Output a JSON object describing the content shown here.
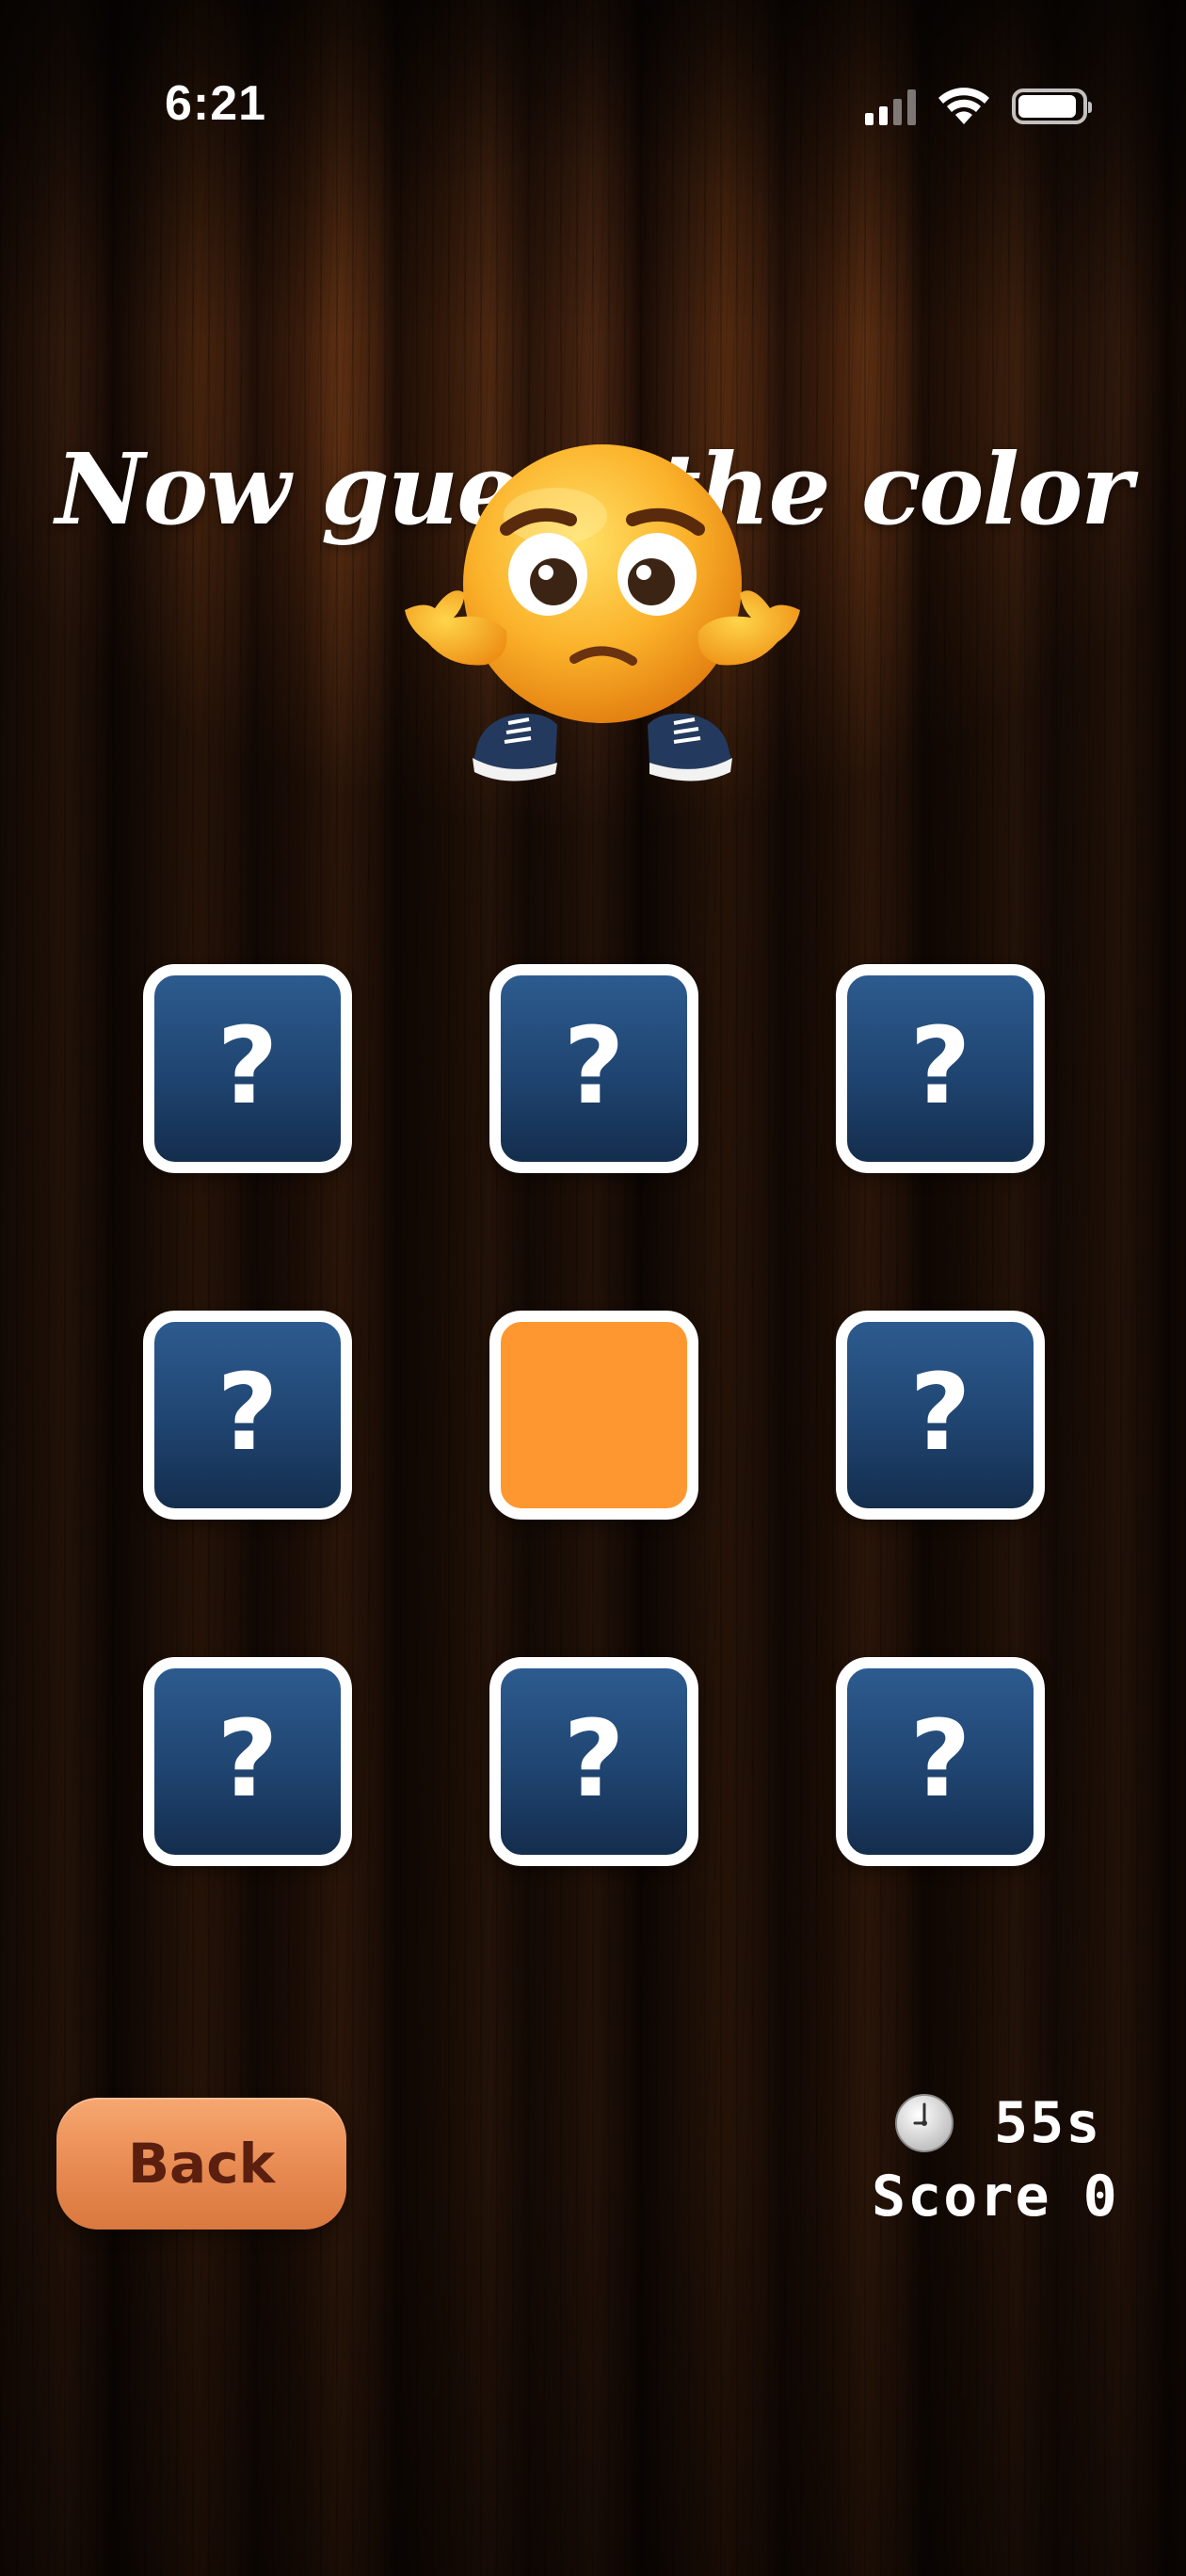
{
  "status_bar": {
    "time": "6:21",
    "icons": [
      "cellular-signal-icon",
      "wifi-icon",
      "battery-icon"
    ]
  },
  "title": "Now guess the color",
  "mascot": {
    "icon": "shrugging-emoji-mascot"
  },
  "grid": {
    "tiles": [
      {
        "label": "?",
        "revealed": false
      },
      {
        "label": "?",
        "revealed": false
      },
      {
        "label": "?",
        "revealed": false
      },
      {
        "label": "?",
        "revealed": false
      },
      {
        "label": "",
        "revealed": true,
        "color": "#ff9730"
      },
      {
        "label": "?",
        "revealed": false
      },
      {
        "label": "?",
        "revealed": false
      },
      {
        "label": "?",
        "revealed": false
      },
      {
        "label": "?",
        "revealed": false
      }
    ],
    "tile_color": "#1f4470",
    "tile_border_color": "#ffffff"
  },
  "controls": {
    "back_label": "Back"
  },
  "hud": {
    "timer_value": "55s",
    "score_label": "Score",
    "score_value": "0",
    "clock_icon": "clock-icon"
  }
}
